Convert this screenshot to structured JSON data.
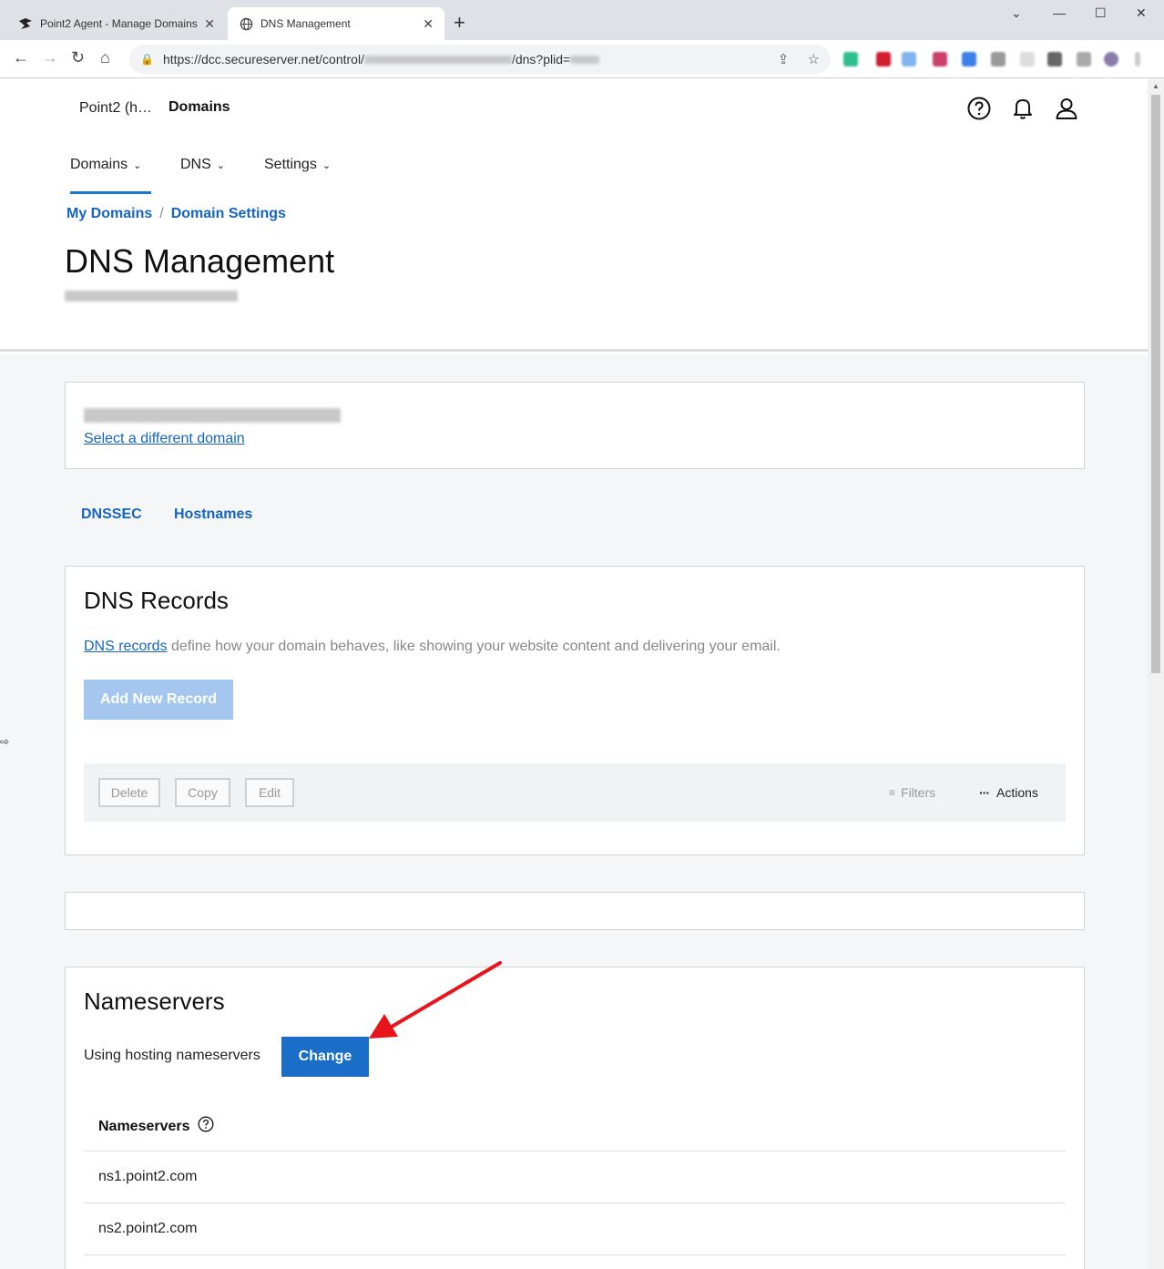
{
  "browser": {
    "tabs": [
      {
        "title": "Point2 Agent - Manage Domains",
        "icon": "point2-logo-icon",
        "active": false
      },
      {
        "title": "DNS Management",
        "icon": "globe-icon",
        "active": true
      }
    ],
    "url_prefix": "https://dcc.secureserver.net/control/",
    "url_suffix": "/dns?plid="
  },
  "header": {
    "account": "Point2 (h…",
    "product": "Domains",
    "nav": [
      {
        "label": "Domains"
      },
      {
        "label": "DNS"
      },
      {
        "label": "Settings"
      }
    ],
    "breadcrumbs": [
      "My Domains",
      "Domain Settings"
    ],
    "title": "DNS Management"
  },
  "domain_card": {
    "select_link": "Select a different domain"
  },
  "subnav": {
    "dnssec": "DNSSEC",
    "hostnames": "Hostnames"
  },
  "dns_records": {
    "title": "DNS Records",
    "desc_link": "DNS records",
    "desc_rest": " define how your domain behaves, like showing your website content and delivering your email.",
    "add_button": "Add New Record",
    "toolbar": {
      "delete": "Delete",
      "copy": "Copy",
      "edit": "Edit",
      "filters": "Filters",
      "actions": "Actions"
    }
  },
  "nameservers": {
    "title": "Nameservers",
    "status": "Using hosting nameservers",
    "change_button": "Change",
    "column_header": "Nameservers",
    "rows": [
      "ns1.point2.com",
      "ns2.point2.com"
    ]
  },
  "colors": {
    "primary": "#1b6ec8",
    "link": "#1565c0",
    "annotation_arrow": "#e8141b"
  }
}
